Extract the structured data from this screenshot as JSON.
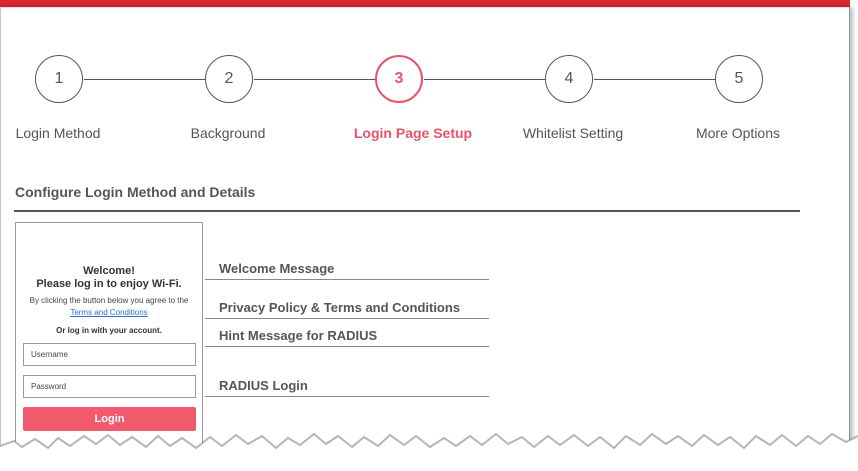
{
  "steps": [
    {
      "number": "1",
      "label": "Login Method"
    },
    {
      "number": "2",
      "label": "Background"
    },
    {
      "number": "3",
      "label": "Login Page Setup"
    },
    {
      "number": "4",
      "label": "Whitelist Setting"
    },
    {
      "number": "5",
      "label": "More Options"
    }
  ],
  "active_step": 3,
  "section": {
    "title": "Configure Login Method and Details"
  },
  "preview": {
    "welcome": "Welcome!",
    "subtitle": "Please log in to enjoy Wi-Fi.",
    "agree_text": "By clicking the button below you agree to the",
    "terms_link": "Terms and Conditions",
    "or_text": "Or log in with your account.",
    "username_placeholder": "Username",
    "password_placeholder": "Password",
    "login_button": "Login"
  },
  "config_items": [
    {
      "label": "Welcome Message"
    },
    {
      "label": "Privacy Policy & Terms and Conditions"
    },
    {
      "label": "Hint Message for RADIUS"
    },
    {
      "label": "RADIUS Login"
    }
  ],
  "colors": {
    "accent": "#e8536a",
    "login_button": "#f05a6c",
    "top_bar": "#d9262c",
    "text": "#555555"
  }
}
